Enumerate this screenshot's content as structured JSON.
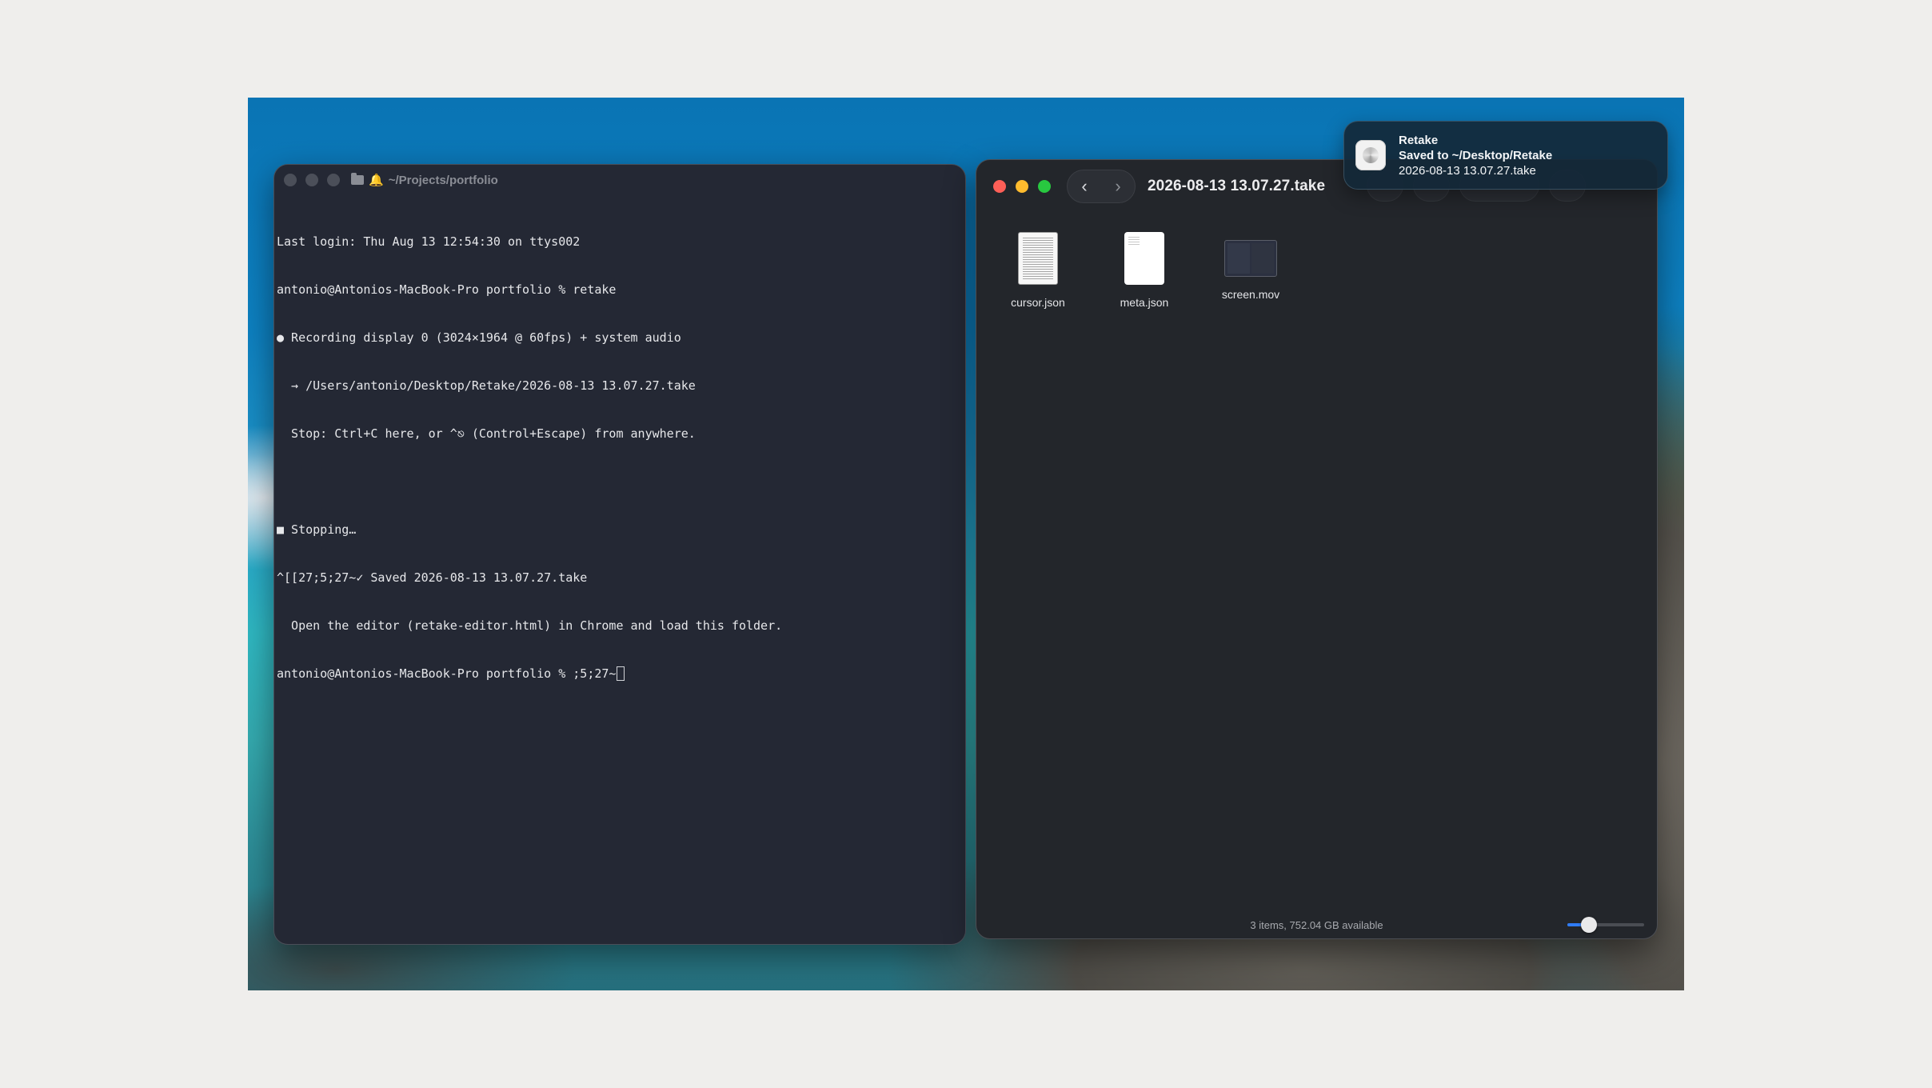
{
  "terminal": {
    "title": "~/Projects/portfolio",
    "lines": [
      "Last login: Thu Aug 13 12:54:30 on ttys002",
      "antonio@Antonios-MacBook-Pro portfolio % retake",
      "● Recording display 0 (3024×1964 @ 60fps) + system audio",
      "  → /Users/antonio/Desktop/Retake/2026-08-13 13.07.27.take",
      "  Stop: Ctrl+C here, or ^⎋ (Control+Escape) from anywhere.",
      "",
      "■ Stopping…",
      "^[[27;5;27~✓ Saved 2026-08-13 13.07.27.take",
      "  Open the editor (retake-editor.html) in Chrome and load this folder.",
      "antonio@Antonios-MacBook-Pro portfolio % ;5;27~"
    ],
    "icons": {
      "folder": "folder-icon",
      "bell": "bell-icon"
    }
  },
  "finder": {
    "title": "2026-08-13 13.07.27.take",
    "nav": {
      "back": "‹",
      "forward": "›"
    },
    "files": [
      {
        "name": "cursor.json",
        "icon": "json-document-icon"
      },
      {
        "name": "meta.json",
        "icon": "json-document-icon"
      },
      {
        "name": "screen.mov",
        "icon": "video-thumbnail-icon"
      }
    ],
    "status": "3 items, 752.04 GB available",
    "icon_size_slider": 0.28,
    "colors": {
      "close": "#fe5f57",
      "minimize": "#febb2e",
      "zoom": "#28c840",
      "slider_accent": "#2f7cf6"
    }
  },
  "notification": {
    "app": "Retake",
    "line1": "Saved to ~/Desktop/Retake",
    "line2": "2026-08-13 13.07.27.take"
  }
}
